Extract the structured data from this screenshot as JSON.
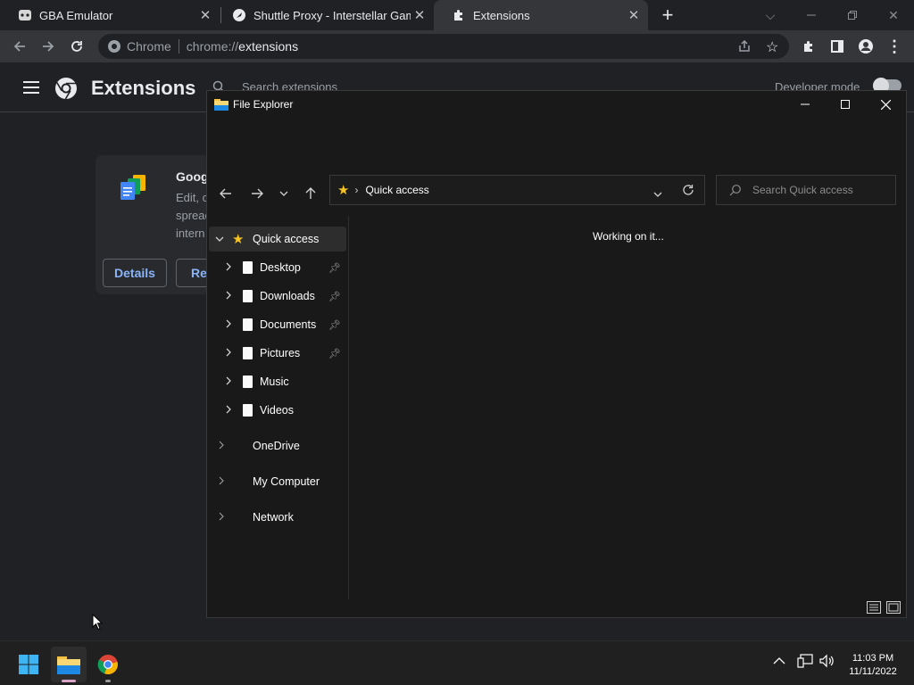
{
  "browser": {
    "tabs": [
      {
        "title": "GBA Emulator",
        "icon": "gba-icon",
        "active": false
      },
      {
        "title": "Shuttle Proxy - Interstellar Games",
        "icon": "rocket-icon",
        "active": false
      },
      {
        "title": "Extensions",
        "icon": "puzzle-icon",
        "active": true
      }
    ],
    "omnibox": {
      "label": "Chrome",
      "url_scheme": "chrome://",
      "url_host": "extensions"
    }
  },
  "extensions_page": {
    "title": "Extensions",
    "search_placeholder": "Search extensions",
    "developer_mode_label": "Developer mode",
    "developer_mode_on": false,
    "card": {
      "name": "Googl",
      "description_lines": [
        "Edit, c",
        "spread",
        "intern"
      ],
      "details_label": "Details",
      "remove_label": "Re"
    }
  },
  "file_explorer": {
    "title": "File Explorer",
    "address": "Quick access",
    "search_placeholder": "Search Quick access",
    "status": "Working on it...",
    "nav": [
      {
        "label": "Quick access",
        "selected": true,
        "expanded": true,
        "icon": "star-icon",
        "pinned": false,
        "level": 0
      },
      {
        "label": "Desktop",
        "icon": "document-icon",
        "pinned": true,
        "level": 1
      },
      {
        "label": "Downloads",
        "icon": "document-icon",
        "pinned": true,
        "level": 1
      },
      {
        "label": "Documents",
        "icon": "document-icon",
        "pinned": true,
        "level": 1
      },
      {
        "label": "Pictures",
        "icon": "document-icon",
        "pinned": true,
        "level": 1
      },
      {
        "label": "Music",
        "icon": "document-icon",
        "pinned": false,
        "level": 1
      },
      {
        "label": "Videos",
        "icon": "document-icon",
        "pinned": false,
        "level": 1
      },
      {
        "label": "OneDrive",
        "icon": "",
        "pinned": false,
        "level": 0
      },
      {
        "label": "My Computer",
        "icon": "",
        "pinned": false,
        "level": 0
      },
      {
        "label": "Network",
        "icon": "",
        "pinned": false,
        "level": 0
      }
    ]
  },
  "taskbar": {
    "apps": [
      "start-icon",
      "file-explorer-icon",
      "chrome-icon"
    ],
    "time": "11:03 PM",
    "date": "11/11/2022"
  },
  "colors": {
    "accent_blue": "#8ab4f8",
    "star_yellow": "#f7c325"
  }
}
